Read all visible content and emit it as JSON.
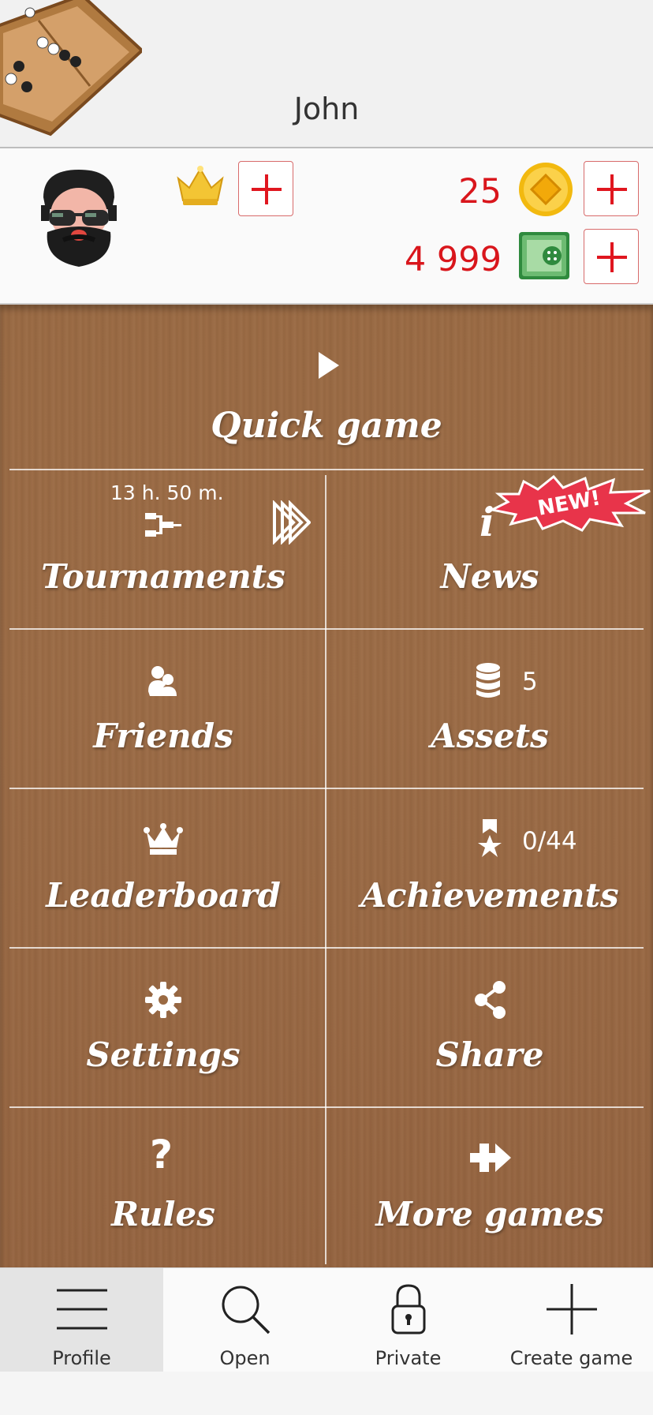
{
  "header": {
    "player_name": "John"
  },
  "stats": {
    "crowns_label": "",
    "coins": "25",
    "money": "4 999"
  },
  "menu": {
    "quick_game": "Quick game",
    "tournaments": {
      "label": "Tournaments",
      "timer": "13 h. 50 m."
    },
    "news": {
      "label": "News",
      "badge": "NEW!"
    },
    "friends": {
      "label": "Friends"
    },
    "assets": {
      "label": "Assets",
      "count": "5"
    },
    "leaderboard": {
      "label": "Leaderboard"
    },
    "achievements": {
      "label": "Achievements",
      "count": "0/44"
    },
    "settings": {
      "label": "Settings"
    },
    "share": {
      "label": "Share"
    },
    "rules": {
      "label": "Rules"
    },
    "more_games": {
      "label": "More games"
    }
  },
  "bottom_nav": [
    {
      "label": "Profile",
      "icon": "hamburger-icon"
    },
    {
      "label": "Open",
      "icon": "search-icon"
    },
    {
      "label": "Private",
      "icon": "lock-icon"
    },
    {
      "label": "Create game",
      "icon": "plus-icon"
    }
  ],
  "colors": {
    "accent_red": "#d9161c",
    "wood": "#9a6a43",
    "badge_red": "#e8344a"
  }
}
